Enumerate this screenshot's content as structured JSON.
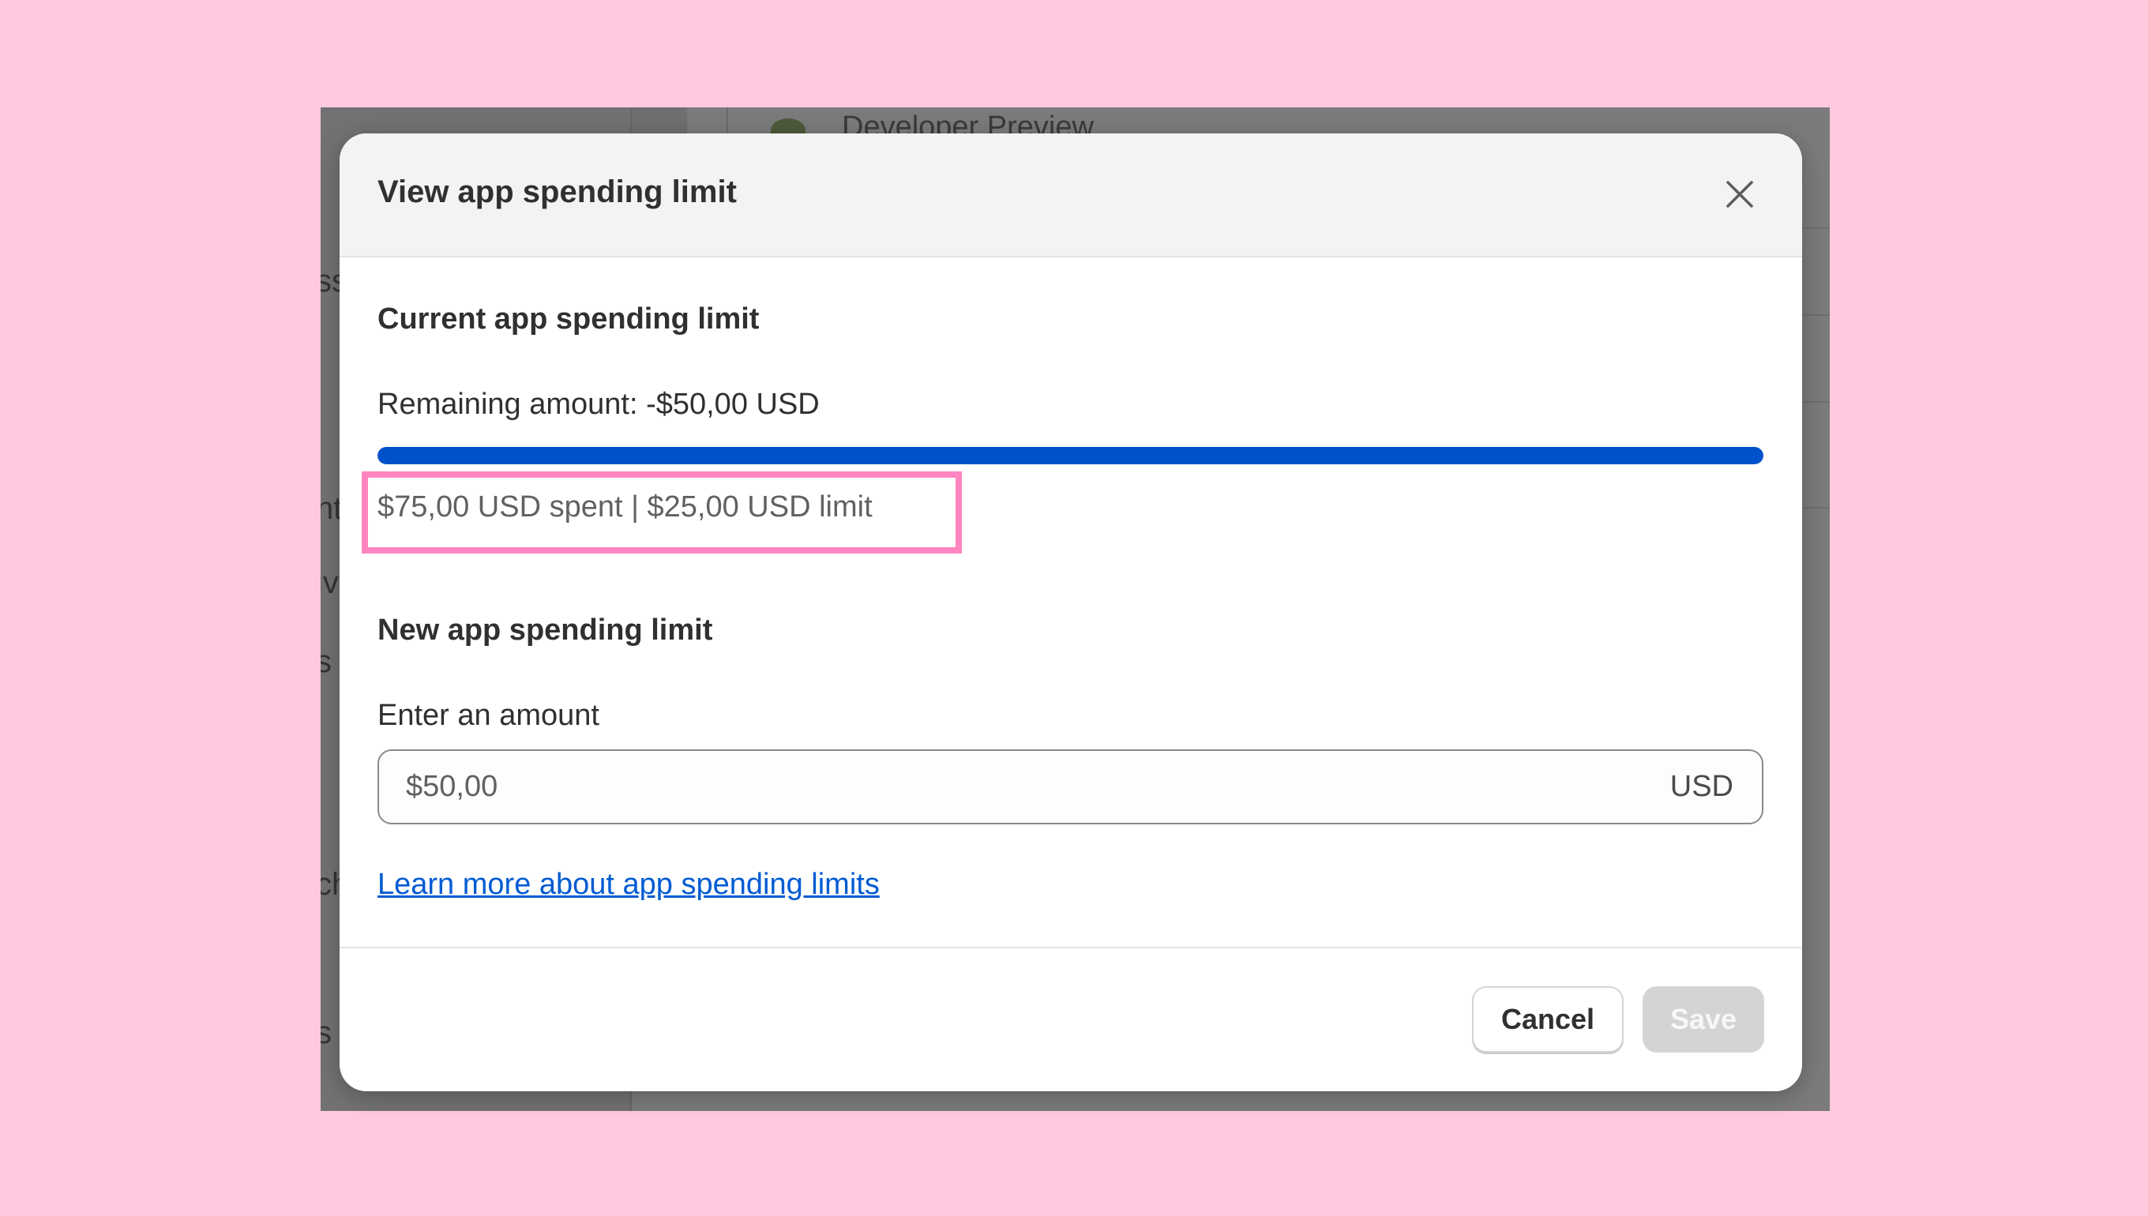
{
  "backdrop": {
    "header_text": "Developer Preview",
    "clipped_texts": [
      "ss",
      "nt",
      "iv",
      "s",
      "ch",
      "s"
    ]
  },
  "modal": {
    "title": "View app spending limit",
    "close_icon": "close-icon"
  },
  "current_limit": {
    "heading": "Current app spending limit",
    "remaining": "Remaining amount: -$50,00 USD",
    "progress_fraction": 1.0,
    "progress_color": "#0052cc",
    "spent_summary": "$75,00 USD spent | $25,00 USD limit",
    "highlight_color": "#ff85c0"
  },
  "new_limit": {
    "heading": "New app spending limit",
    "input_label": "Enter an amount",
    "input_placeholder": "$50,00",
    "input_value": "",
    "currency_suffix": "USD"
  },
  "learn_more": {
    "label": "Learn more about app spending limits"
  },
  "footer": {
    "cancel_label": "Cancel",
    "save_label": "Save",
    "save_disabled": true
  }
}
